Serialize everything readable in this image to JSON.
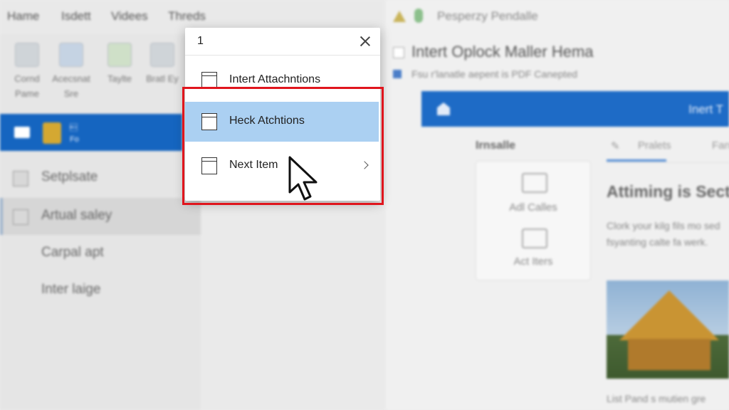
{
  "top_tabs": [
    "Hame",
    "Isdett",
    "Videes",
    "Threds"
  ],
  "ribbon": [
    {
      "label": "Cornd Pame",
      "icon": "document-icon"
    },
    {
      "label": "Acecsnat Sre",
      "icon": "photo-icon"
    },
    {
      "label": "Taylte",
      "icon": "pen-icon"
    },
    {
      "label": "Bratl Ey",
      "icon": "gear-icon"
    }
  ],
  "sidebar": {
    "selected_line1": "\u0012",
    "selected_line2": "Fo",
    "items": [
      {
        "label": "Setplsate"
      },
      {
        "label": "Artual saley"
      },
      {
        "label": "Carpal apt"
      },
      {
        "label": "Inter laige"
      }
    ]
  },
  "right": {
    "app_title": "Pesperzy Pendalle",
    "subject": "Intert Oplock Maller Hema",
    "subtitle": "Fsu r'lanatle aepent is PDF Canepted",
    "header_title": "Inert T",
    "install_label": "Irnsalle",
    "card_items": [
      "Adl Calles",
      "Act Iters"
    ],
    "tabs": [
      "Pralets",
      "Fan"
    ],
    "article_title": "Attiming is Sect",
    "article_body": "Clork your kilg fils mo sed fsyanting calte fa werk.",
    "caption": "List Pand s mutien gre"
  },
  "popup": {
    "title": "1",
    "items": [
      {
        "label": "Intert Attachntions"
      },
      {
        "label": "Heck Atchtions"
      },
      {
        "label": "Next Item"
      }
    ]
  },
  "colors": {
    "accent": "#1565c0",
    "highlight": "#abd0f2",
    "annotation_red": "#e0151d"
  }
}
